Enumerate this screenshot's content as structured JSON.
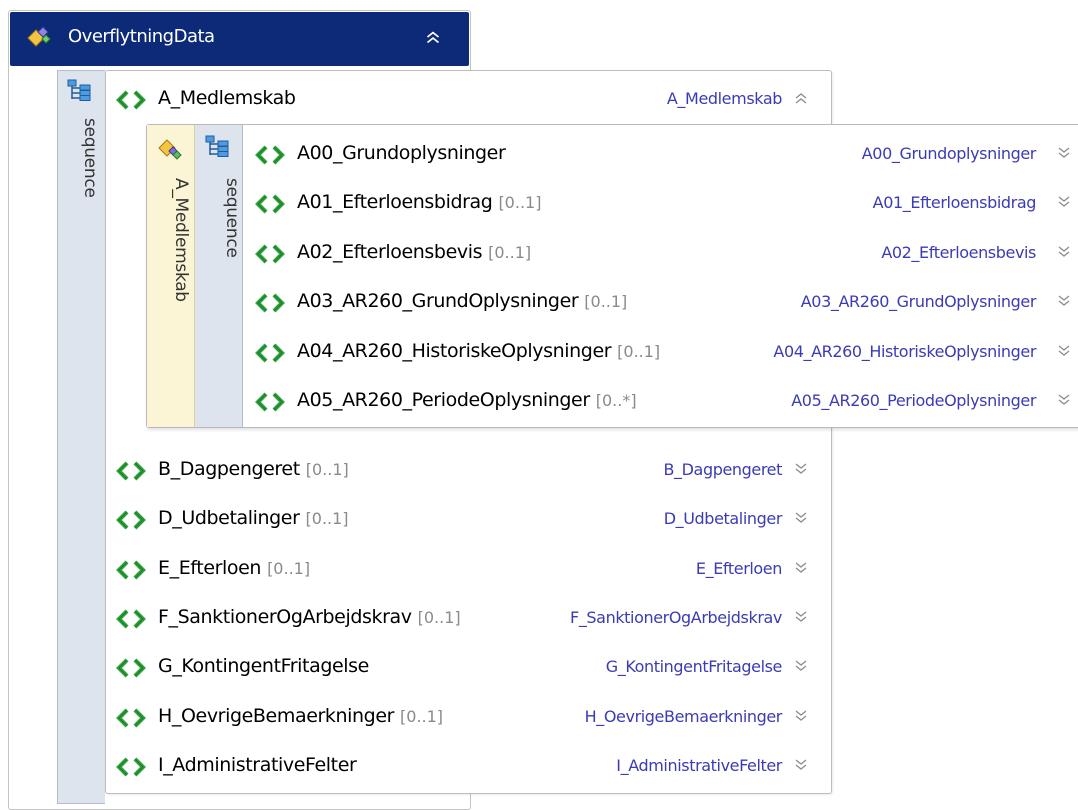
{
  "root": {
    "name": "OverflytningData"
  },
  "outer_sequence": {
    "label": "sequence"
  },
  "a_element": {
    "name": "A_Medlemskab",
    "type": "A_Medlemskab"
  },
  "nested": {
    "group_label": "A_Medlemskab",
    "sequence_label": "sequence",
    "children": [
      {
        "name": "A00_Grundoplysninger",
        "mult": "",
        "type": "A00_Grundoplysninger"
      },
      {
        "name": "A01_Efterloensbidrag",
        "mult": "[0..1]",
        "type": "A01_Efterloensbidrag"
      },
      {
        "name": "A02_Efterloensbevis",
        "mult": "[0..1]",
        "type": "A02_Efterloensbevis"
      },
      {
        "name": "A03_AR260_GrundOplysninger",
        "mult": "[0..1]",
        "type": "A03_AR260_GrundOplysninger"
      },
      {
        "name": "A04_AR260_HistoriskeOplysninger",
        "mult": "[0..1]",
        "type": "A04_AR260_HistoriskeOplysninger"
      },
      {
        "name": "A05_AR260_PeriodeOplysninger",
        "mult": "[0..*]",
        "type": "A05_AR260_PeriodeOplysninger"
      }
    ]
  },
  "siblings": [
    {
      "name": "B_Dagpengeret",
      "mult": "[0..1]",
      "type": "B_Dagpengeret"
    },
    {
      "name": "D_Udbetalinger",
      "mult": "[0..1]",
      "type": "D_Udbetalinger"
    },
    {
      "name": "E_Efterloen",
      "mult": "[0..1]",
      "type": "E_Efterloen"
    },
    {
      "name": "F_SanktionerOgArbejdskrav",
      "mult": "[0..1]",
      "type": "F_SanktionerOgArbejdskrav"
    },
    {
      "name": "G_KontingentFritagelse",
      "mult": "",
      "type": "G_KontingentFritagelse"
    },
    {
      "name": "H_OevrigeBemaerkninger",
      "mult": "[0..1]",
      "type": "H_OevrigeBemaerkninger"
    },
    {
      "name": "I_AdministrativeFelter",
      "mult": "",
      "type": "I_AdministrativeFelter"
    }
  ],
  "icons": {
    "root": "complex-type-icon",
    "sequence": "sequence-icon",
    "group": "group-icon",
    "element": "element-icon",
    "collapse": "double-chevron-up-icon",
    "expand": "double-chevron-down-icon"
  },
  "colors": {
    "header_bg": "#0c2a78",
    "type_text": "#3b3bb5",
    "mult_text": "#8a8a8a",
    "sequence_bg": "#dde4ee",
    "group_bg": "#fbf5d6",
    "element_icon": "#2ea43a"
  }
}
